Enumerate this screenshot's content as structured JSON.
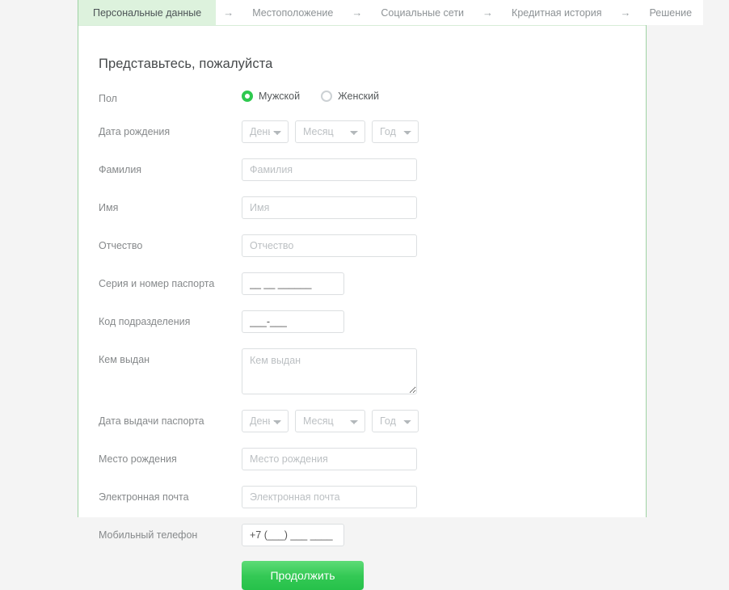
{
  "stepper": {
    "arrow_glyph": "→",
    "steps": [
      {
        "label": "Персональные данные",
        "active": true
      },
      {
        "label": "Местоположение",
        "active": false
      },
      {
        "label": "Социальные сети",
        "active": false
      },
      {
        "label": "Кредитная история",
        "active": false
      },
      {
        "label": "Решение",
        "active": false
      }
    ]
  },
  "form": {
    "title": "Представьтесь, пожалуйста",
    "gender": {
      "label": "Пол",
      "options": [
        {
          "label": "Мужской",
          "selected": true
        },
        {
          "label": "Женский",
          "selected": false
        }
      ]
    },
    "birth_date": {
      "label": "Дата рождения",
      "day_placeholder": "День",
      "month_placeholder": "Месяц",
      "year_placeholder": "Год"
    },
    "last_name": {
      "label": "Фамилия",
      "placeholder": "Фамилия",
      "value": ""
    },
    "first_name": {
      "label": "Имя",
      "placeholder": "Имя",
      "value": ""
    },
    "middle_name": {
      "label": "Отчество",
      "placeholder": "Отчество",
      "value": ""
    },
    "passport_number": {
      "label": "Серия и номер паспорта",
      "value": "__ __ ______"
    },
    "department_code": {
      "label": "Код подразделения",
      "value": "___-___"
    },
    "issued_by": {
      "label": "Кем выдан",
      "placeholder": "Кем выдан",
      "value": ""
    },
    "issue_date": {
      "label": "Дата выдачи паспорта",
      "day_placeholder": "День",
      "month_placeholder": "Месяц",
      "year_placeholder": "Год"
    },
    "birth_place": {
      "label": "Место рождения",
      "placeholder": "Место рождения",
      "value": ""
    },
    "email": {
      "label": "Электронная почта",
      "placeholder": "Электронная почта",
      "value": ""
    },
    "phone": {
      "label": "Мобильный телефон",
      "value": "+7 (___) ___ ____"
    },
    "submit_label": "Продолжить"
  },
  "colors": {
    "accent_green": "#2ec94f",
    "active_tab_bg": "#ddf2dd",
    "card_border": "#9fd2a4",
    "page_bg": "#f4f4f4",
    "label_text": "#86898b",
    "placeholder_text": "#bcc0c3"
  }
}
